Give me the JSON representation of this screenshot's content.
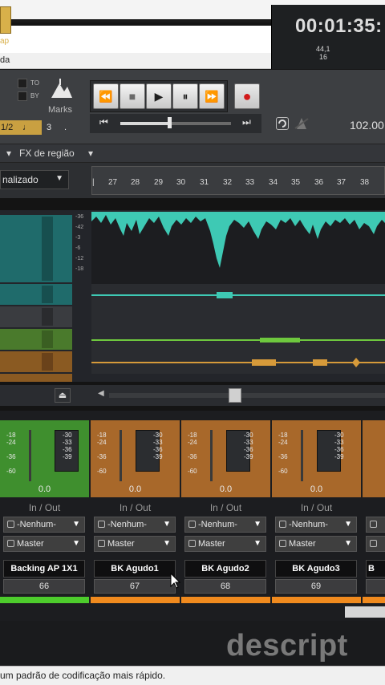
{
  "menu": {
    "label": "da"
  },
  "toolbar": {
    "snap_label": "ap",
    "to_label": "TO",
    "by_label": "BY",
    "marks_label": "Marks",
    "fraction": "1/2",
    "note_glyph": "♩",
    "beat_value": "3",
    "dot": ".",
    "transport": {
      "rewind": "⏪",
      "stop": "■",
      "play": "▶",
      "pause": "⏸",
      "forward": "⏩",
      "record": "●"
    },
    "time": "00:01:35:",
    "sample_rate": "44,1",
    "bit_depth": "16",
    "tempo": "102.00"
  },
  "track_bar": {
    "fx_region": "FX de região",
    "view_mode": "nalizado"
  },
  "ruler": {
    "ticks": [
      "27",
      "28",
      "29",
      "30",
      "31",
      "32",
      "33",
      "34",
      "35",
      "36",
      "37",
      "38"
    ]
  },
  "track_meter_labels": [
    "-36",
    "-42",
    "-3",
    "-6",
    "-12",
    "-18"
  ],
  "mixer": {
    "meter_scale": [
      "-18",
      "-24",
      "-36",
      "-60"
    ],
    "meter_scale_right": [
      "-30",
      "-33",
      "-36",
      "-39"
    ],
    "strips": [
      {
        "gain": "0.0",
        "inout": "In / Out",
        "input": "-Nenhum-",
        "output": "Master",
        "name": "Backing AP 1X1",
        "number": "66",
        "color": "#3f8f2e",
        "bar": "#4dcc2c"
      },
      {
        "gain": "0.0",
        "inout": "In / Out",
        "input": "-Nenhum-",
        "output": "Master",
        "name": "BK  Agudo1",
        "number": "67",
        "color": "#a8682a",
        "bar": "#f08a1e"
      },
      {
        "gain": "0.0",
        "inout": "In / Out",
        "input": "-Nenhum-",
        "output": "Master",
        "name": "BK  Agudo2",
        "number": "68",
        "color": "#a8682a",
        "bar": "#f08a1e"
      },
      {
        "gain": "0.0",
        "inout": "In / Out",
        "input": "-Nenhum-",
        "output": "Master",
        "name": "BK  Agudo3",
        "number": "69",
        "color": "#a8682a",
        "bar": "#f08a1e"
      },
      {
        "gain": "",
        "inout": "",
        "input": "",
        "output": "",
        "name": "B",
        "number": "",
        "color": "#a8682a",
        "bar": "#f08a1e"
      }
    ]
  },
  "watermark": "descript",
  "status": {
    "text": "um padrão de codificação mais rápido."
  }
}
